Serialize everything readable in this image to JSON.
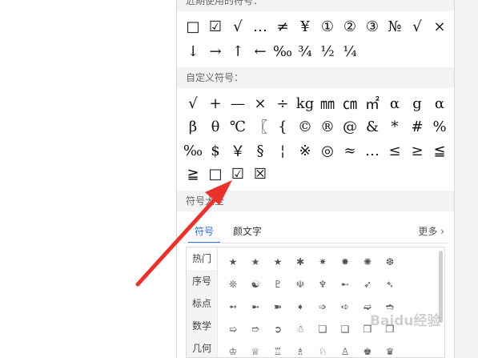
{
  "recent": {
    "header": "近期使用的符号：",
    "row1": [
      "□",
      "☑",
      "√",
      "…",
      "≠",
      "¥",
      "①",
      "②",
      "③",
      "№",
      "√",
      "×"
    ],
    "row2": [
      "↓",
      "→",
      "↑",
      "←",
      "‰",
      "¾",
      "½",
      "¼"
    ]
  },
  "custom": {
    "header": "自定义符号：",
    "row1": [
      "√",
      "+",
      "—",
      "×",
      "÷",
      "kg",
      "㎜",
      "㎝",
      "㎡",
      "α",
      "g",
      "α"
    ],
    "row2": [
      "β",
      "θ",
      "℃",
      "〖",
      "{",
      "©",
      "®",
      "@",
      "&",
      "*",
      "#",
      "%"
    ],
    "row3": [
      "‰",
      "$",
      "￥",
      "§",
      "¦",
      "※",
      "◎",
      "≈",
      "…",
      "≤",
      "≥",
      "≦"
    ],
    "row4": [
      "≧",
      "□",
      "☑",
      "☒"
    ]
  },
  "library": {
    "header": "符号大全",
    "tabs": [
      "符号",
      "颜文字"
    ],
    "more": "更多",
    "categories": [
      "热门",
      "序号",
      "标点",
      "数学",
      "几何"
    ],
    "rows": [
      [
        "★",
        "★",
        "★",
        "✱",
        "✷",
        "✹",
        "✺",
        "❆",
        ""
      ],
      [
        "❊",
        "☯",
        "♇",
        "☫",
        "♆",
        "➸",
        "➶",
        "➴",
        ""
      ],
      [
        "➻",
        "➼",
        "➽",
        "➧",
        "➩",
        "➪",
        "➫",
        "➬",
        ""
      ],
      [
        "➯",
        "➱",
        "➲",
        "☃",
        "❏",
        "❑",
        "❒",
        "❐",
        ""
      ],
      [
        "♔",
        "♕",
        "♖",
        "♗",
        "♘",
        "♙",
        "♚",
        "♛",
        ""
      ]
    ]
  },
  "watermark": "Baidu经验",
  "colors": {
    "accent": "#2f6fd6",
    "arrow": "#e8322b"
  }
}
